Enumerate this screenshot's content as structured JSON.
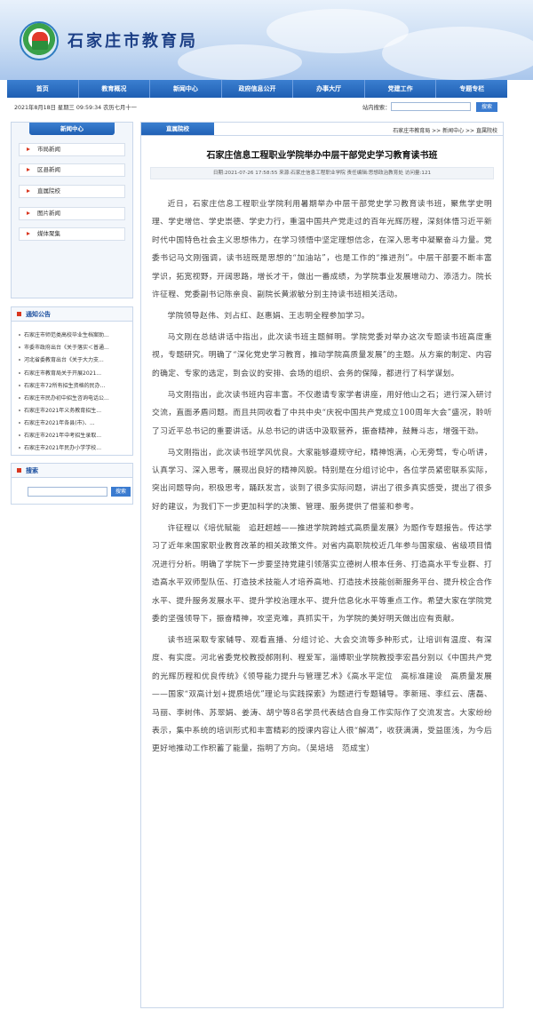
{
  "header": {
    "site_title": "石家庄市教育局"
  },
  "nav": {
    "items": [
      {
        "label": "首页"
      },
      {
        "label": "教育概况"
      },
      {
        "label": "新闻中心"
      },
      {
        "label": "政府信息公开"
      },
      {
        "label": "办事大厅"
      },
      {
        "label": "党建工作"
      },
      {
        "label": "专题专栏"
      }
    ]
  },
  "infobar": {
    "date": "2021年8月18日 星期三 09:59:34 农历七月十一",
    "search_label": "站内搜索：",
    "search_button": "搜索"
  },
  "sidebar": {
    "news_center": {
      "title": "新闻中心",
      "items": [
        {
          "label": "市局新闻"
        },
        {
          "label": "区县新闻"
        },
        {
          "label": "直属院校"
        },
        {
          "label": "图片新闻"
        },
        {
          "label": "媒体聚集"
        }
      ]
    },
    "notices": {
      "title": "通知公告",
      "items": [
        {
          "label": "石家庄市师范类高校毕业生档案助..."
        },
        {
          "label": "市委市政府出台《关于落实＜普通..."
        },
        {
          "label": "河北省委教育出台《关于大力支..."
        },
        {
          "label": "石家庄市教育局关于开展2021..."
        },
        {
          "label": "石家庄市72所有招生资格的民办..."
        },
        {
          "label": "石家庄市民办初中招生咨询电话公..."
        },
        {
          "label": "石家庄市2021年义务教育招生..."
        },
        {
          "label": "石家庄市2021年各县(市)、..."
        },
        {
          "label": "石家庄市2021年中考招生录取..."
        },
        {
          "label": "石家庄市2021年民办小学学校..."
        }
      ]
    },
    "search": {
      "title": "搜索",
      "button": "搜索"
    }
  },
  "main": {
    "tab": "直属院校",
    "breadcrumb": "石家庄市教育局 >> 新闻中心 >> 直属院校",
    "title": "石家庄信息工程职业学院举办中层干部党史学习教育读书班",
    "meta": "日期:2021-07-26 17:58:55    来源:石家庄信息工程职业学院    责任编辑:思想政治教育处    访问量:121",
    "paragraphs": [
      "近日，石家庄信息工程职业学院利用暑期举办中层干部党史学习教育读书班，聚焦学史明理、学史增信、学史崇德、学史力行，重温中国共产党走过的百年光辉历程，深刻体悟习近平新时代中国特色社会主义思想伟力，在学习领悟中坚定理想信念，在深入思考中凝聚奋斗力量。党委书记马文刚强调，读书班既是思想的“加油站”，也是工作的“推进剂”。中层干部要不断丰富学识，拓宽视野，开阔思路，增长才干，做出一番成绩，为学院事业发展增动力、添活力。院长许征程、党委副书记陈亲良、副院长黄淑敏分别主持读书班相关活动。",
      "学院领导赵伟、刘占红、赵惠娟、王志明全程参加学习。",
      "马文刚在总结讲话中指出，此次读书班主题鲜明。学院党委对举办这次专题读书班高度重视，专题研究。明确了“深化党史学习教育，推动学院高质量发展”的主题。从方案的制定、内容的确定、专家的选定，到会议的安排、会场的组织、会务的保障，都进行了科学谋划。",
      "马文刚指出，此次读书班内容丰富。不仅邀请专家学者讲座，用好他山之石；进行深入研讨交流，直面矛盾问题。而且共同收看了中共中央“庆祝中国共产党成立100周年大会”盛况，聆听了习近平总书记的重要讲话。从总书记的讲话中汲取营养，振奋精神，鼓舞斗志，增强干劲。",
      "马文刚指出，此次读书班学风优良。大家能够遵规守纪，精神饱满，心无旁骛，专心听讲，认真学习、深入思考，展现出良好的精神风貌。特别是在分组讨论中，各位学员紧密联系实际，突出问题导向，积极思考，踊跃发言，谈到了很多实际问题，讲出了很多真实感受，提出了很多好的建议，为我们下一步更加科学的决策、管理、服务提供了借鉴和参考。",
      "许征程以《培优赋能　追赶超越——推进学院跨越式高质量发展》为题作专题报告。传达学习了近年来国家职业教育改革的相关政策文件。对省内高职院校近几年参与国家级、省级项目情况进行分析。明确了学院下一步要坚持党建引领落实立德树人根本任务、打造高水平专业群、打造高水平双师型队伍、打造技术技能人才培养高地、打造技术技能创新服务平台、提升校企合作水平、提升服务发展水平、提升学校治理水平、提升信息化水平等重点工作。希望大家在学院党委的坚强领导下，振奋精神，攻坚克难，真抓实干，为学院的美好明天做出应有贡献。",
      "读书班采取专家辅导、观看直播、分组讨论、大会交流等多种形式，让培训有温度、有深度、有实度。河北省委党校教授郝刚利、程爱军，淄博职业学院教授李宏昌分别以《中国共产党的光辉历程和优良传统》《领导能力提升与管理艺术》《高水平定位　高标准建设　高质量发展——国家“双高计划+提质培优”理论与实践探索》为题进行专题辅导。李新瑶、李红云、唐磊、马丽、李树伟、苏翠娟、姜涛、胡宁等8名学员代表结合自身工作实际作了交流发言。大家纷纷表示，集中系统的培训形式和丰富精彩的授课内容让人很“解渴”，收获满满，受益匪浅，为今后更好地推动工作积蓄了能量，指明了方向。（吴培培　范成宝）"
    ]
  }
}
